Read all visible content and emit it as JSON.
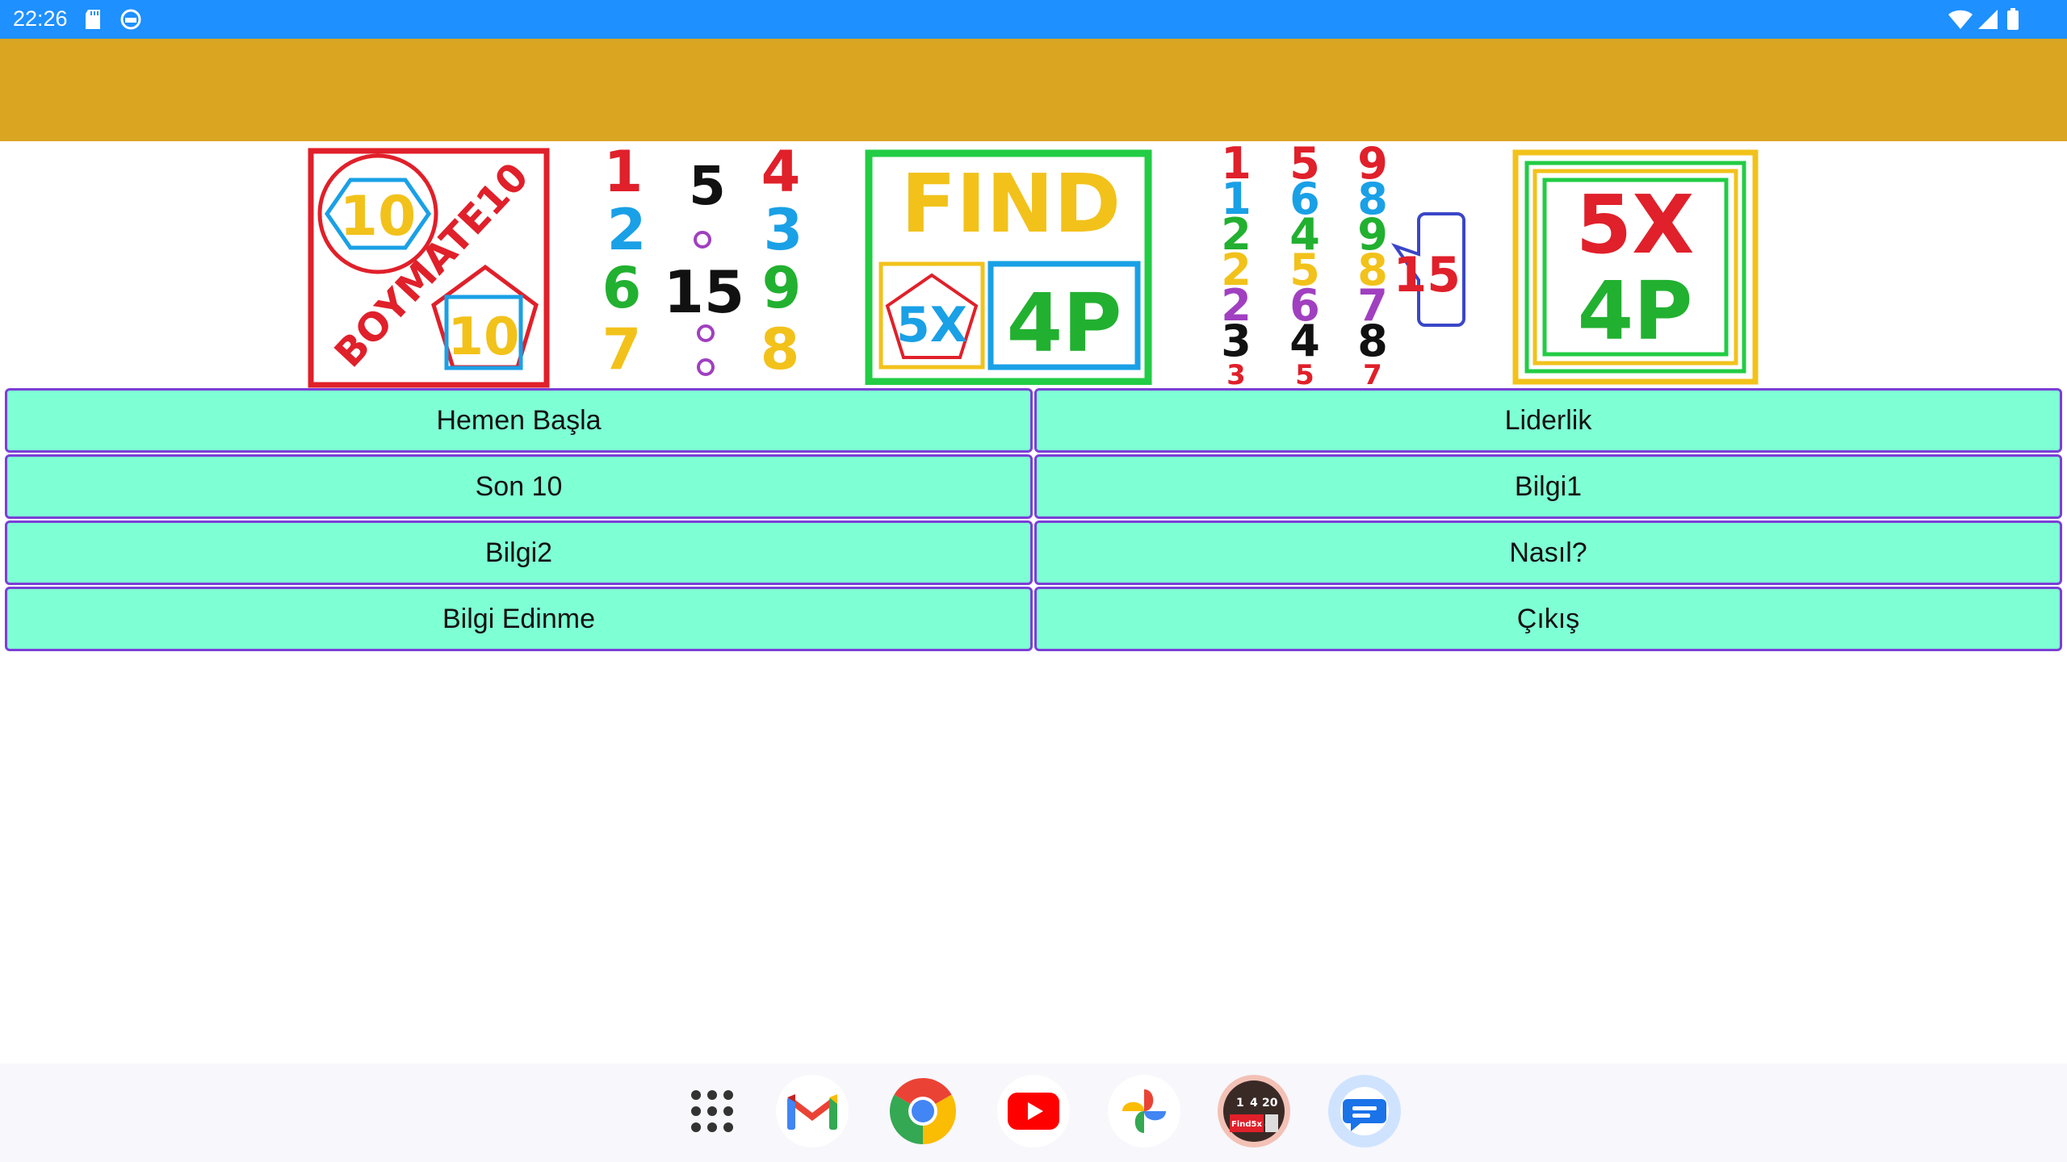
{
  "status_bar": {
    "time": "22:26",
    "icons_left": [
      "sd-card-icon",
      "app-notification-icon"
    ],
    "icons_right": [
      "wifi-icon",
      "signal-icon",
      "battery-icon"
    ]
  },
  "banner": {
    "logos": [
      {
        "name": "boymate10-logo",
        "text": "BOYMATE10",
        "numbers": [
          "10",
          "10"
        ]
      },
      {
        "name": "number-grid-15-logo",
        "numbers": [
          "1",
          "5",
          "4",
          "2",
          "3",
          "6",
          "15",
          "9",
          "7",
          "8"
        ]
      },
      {
        "name": "find-5x-4p-logo",
        "text": "FIND",
        "labels": [
          "5X",
          "4P"
        ]
      },
      {
        "name": "number-columns-15-logo",
        "numbers": [
          "1",
          "5",
          "9",
          "1",
          "6",
          "8",
          "2",
          "4",
          "9",
          "2",
          "5",
          "8",
          "2",
          "6",
          "7",
          "3",
          "4",
          "8",
          "3",
          "5",
          "7"
        ],
        "bubble": "15"
      },
      {
        "name": "5x-4p-logo",
        "labels": [
          "5X",
          "4P"
        ]
      }
    ]
  },
  "menu": {
    "buttons": [
      "Hemen Başla",
      "Liderlik",
      "Son 10",
      "Bilgi1",
      "Bilgi2",
      "Nasıl?",
      "Bilgi Edinme",
      "Çıkış"
    ]
  },
  "dock": {
    "apps": [
      "app-drawer-icon",
      "gmail-icon",
      "chrome-icon",
      "youtube-icon",
      "photos-icon",
      "find-5x-4p-app-icon",
      "messages-icon"
    ],
    "app_icon_numbers": [
      "1",
      "4",
      "20"
    ],
    "app_icon_text": "Find5x 4P"
  },
  "colors": {
    "status_bar": "#1e90ff",
    "top_bar": "#daa520",
    "button_fill": "#7fffd4",
    "button_border": "#7b3fd6"
  }
}
